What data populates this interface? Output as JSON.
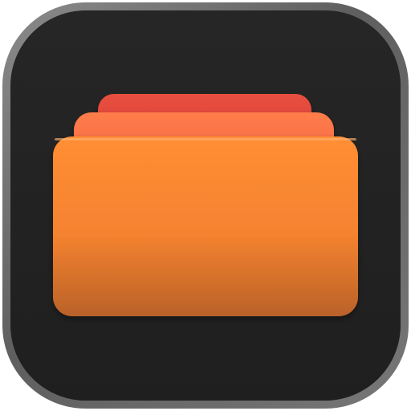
{
  "app_icon": {
    "icon_name": "stacked-folders-icon",
    "colors": {
      "frame": "#6d6d6d",
      "background": "#232323",
      "back_card": "#e4433f",
      "middle_card": "#f46a45",
      "front_card_top": "#ff8e34",
      "front_card_bottom": "#ba6229"
    }
  }
}
